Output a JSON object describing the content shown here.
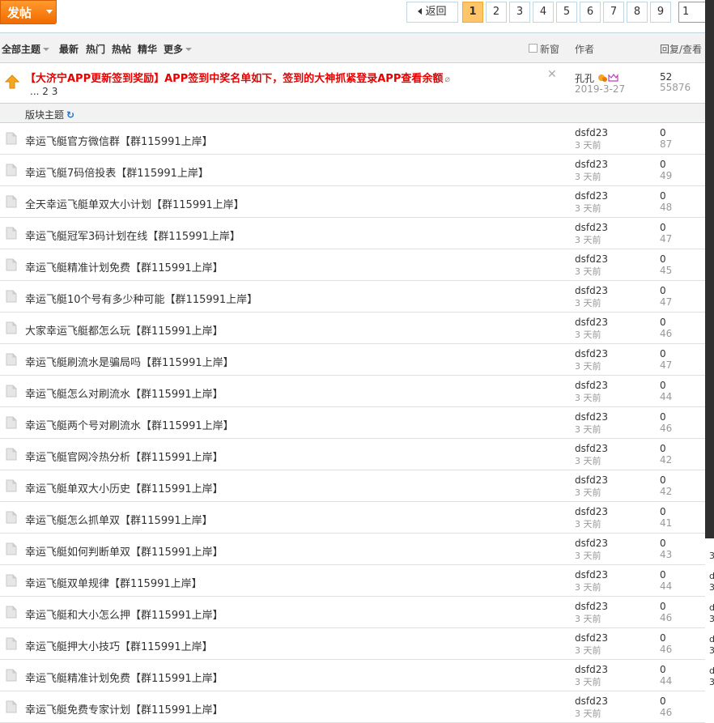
{
  "top": {
    "post_button": "发帖",
    "back": "返回",
    "pages": [
      "1",
      "2",
      "3",
      "4",
      "5",
      "6",
      "7",
      "8",
      "9"
    ],
    "current_page": "1",
    "page_input": "1"
  },
  "filter": {
    "all_topics": "全部主题",
    "latest": "最新",
    "hot": "热门",
    "hot_posts": "热帖",
    "digest": "精华",
    "more": "更多",
    "new_window": "新窗",
    "author_col": "作者",
    "reply_col": "回复/查看"
  },
  "sticky": {
    "title": "【大济宁APP更新签到奖励】APP签到中奖名单如下，签到的大神抓紧登录APP查看余额",
    "pages": "... 2  3",
    "author": "孔孔",
    "date": "2019-3-27",
    "replies": "52",
    "views": "55876"
  },
  "section": {
    "label": "版块主题"
  },
  "threads": [
    {
      "title": "幸运飞艇官方微信群【群115991上岸】",
      "author": "dsfd23",
      "date": "3 天前",
      "replies": "0",
      "views": "87"
    },
    {
      "title": "幸运飞艇7码倍投表【群115991上岸】",
      "author": "dsfd23",
      "date": "3 天前",
      "replies": "0",
      "views": "49"
    },
    {
      "title": "全天幸运飞艇单双大小计划【群115991上岸】",
      "author": "dsfd23",
      "date": "3 天前",
      "replies": "0",
      "views": "48"
    },
    {
      "title": "幸运飞艇冠军3码计划在线【群115991上岸】",
      "author": "dsfd23",
      "date": "3 天前",
      "replies": "0",
      "views": "47"
    },
    {
      "title": "幸运飞艇精准计划免费【群115991上岸】",
      "author": "dsfd23",
      "date": "3 天前",
      "replies": "0",
      "views": "45"
    },
    {
      "title": "幸运飞艇10个号有多少种可能【群115991上岸】",
      "author": "dsfd23",
      "date": "3 天前",
      "replies": "0",
      "views": "47"
    },
    {
      "title": "大家幸运飞艇都怎么玩【群115991上岸】",
      "author": "dsfd23",
      "date": "3 天前",
      "replies": "0",
      "views": "46"
    },
    {
      "title": "幸运飞艇刷流水是骗局吗【群115991上岸】",
      "author": "dsfd23",
      "date": "3 天前",
      "replies": "0",
      "views": "47"
    },
    {
      "title": "幸运飞艇怎么对刷流水【群115991上岸】",
      "author": "dsfd23",
      "date": "3 天前",
      "replies": "0",
      "views": "44"
    },
    {
      "title": "幸运飞艇两个号对刷流水【群115991上岸】",
      "author": "dsfd23",
      "date": "3 天前",
      "replies": "0",
      "views": "46"
    },
    {
      "title": "幸运飞艇官网冷热分析【群115991上岸】",
      "author": "dsfd23",
      "date": "3 天前",
      "replies": "0",
      "views": "42"
    },
    {
      "title": "幸运飞艇单双大小历史【群115991上岸】",
      "author": "dsfd23",
      "date": "3 天前",
      "replies": "0",
      "views": "42"
    },
    {
      "title": "幸运飞艇怎么抓单双【群115991上岸】",
      "author": "dsfd23",
      "date": "3 天前",
      "replies": "0",
      "views": "41"
    },
    {
      "title": "幸运飞艇如何判断单双【群115991上岸】",
      "author": "dsfd23",
      "date": "3 天前",
      "replies": "0",
      "views": "43"
    },
    {
      "title": "幸运飞艇双单规律【群115991上岸】",
      "author": "dsfd23",
      "date": "3 天前",
      "replies": "0",
      "views": "44"
    },
    {
      "title": "幸运飞艇和大小怎么押【群115991上岸】",
      "author": "dsfd23",
      "date": "3 天前",
      "replies": "0",
      "views": "46"
    },
    {
      "title": "幸运飞艇押大小技巧【群115991上岸】",
      "author": "dsfd23",
      "date": "3 天前",
      "replies": "0",
      "views": "46"
    },
    {
      "title": "幸运飞艇精准计划免费【群115991上岸】",
      "author": "dsfd23",
      "date": "3 天前",
      "replies": "0",
      "views": "44"
    },
    {
      "title": "幸运飞艇免费专家计划【群115991上岸】",
      "author": "dsfd23",
      "date": "3 天前",
      "replies": "0",
      "views": "46"
    }
  ],
  "edge_chars": [
    "3",
    "3",
    "d",
    "3",
    "d",
    "3",
    "d",
    "3",
    "d"
  ]
}
